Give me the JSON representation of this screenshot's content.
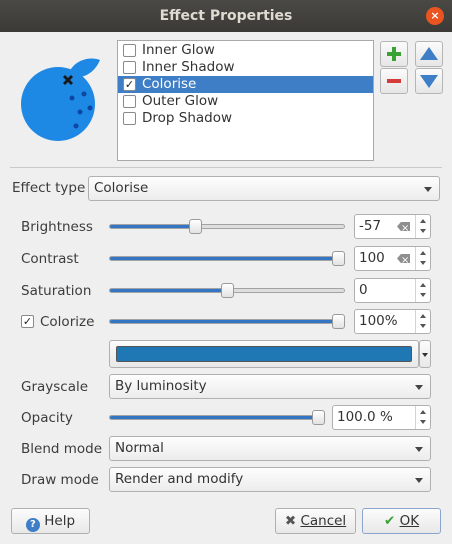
{
  "window": {
    "title": "Effect Properties",
    "close_glyph": "×"
  },
  "effects": [
    {
      "label": "Inner Glow",
      "checked": false,
      "selected": false
    },
    {
      "label": "Inner Shadow",
      "checked": false,
      "selected": false
    },
    {
      "label": "Colorise",
      "checked": true,
      "selected": true
    },
    {
      "label": "Outer Glow",
      "checked": false,
      "selected": false
    },
    {
      "label": "Drop Shadow",
      "checked": false,
      "selected": false
    }
  ],
  "effect_type": {
    "label": "Effect type",
    "value": "Colorise"
  },
  "brightness": {
    "label": "Brightness",
    "value": "-57",
    "level": 0.355
  },
  "contrast": {
    "label": "Contrast",
    "value": "100",
    "level": 1.0
  },
  "saturation": {
    "label": "Saturation",
    "value": "0",
    "level": 0.5
  },
  "colorize": {
    "label": "Colorize",
    "checked": true,
    "value": "100%",
    "level": 1.0,
    "color": "#1f77b4"
  },
  "grayscale": {
    "label": "Grayscale",
    "value": "By luminosity"
  },
  "opacity": {
    "label": "Opacity",
    "value": "100.0 %",
    "level": 1.0
  },
  "blend_mode": {
    "label": "Blend mode",
    "value": "Normal"
  },
  "draw_mode": {
    "label": "Draw mode",
    "value": "Render and modify"
  },
  "buttons": {
    "help": "Help",
    "cancel": "Cancel",
    "ok": "OK"
  },
  "colors": {
    "accent": "#3576c4",
    "preview": "#1e88e5",
    "selection": "#3d7ec6"
  }
}
